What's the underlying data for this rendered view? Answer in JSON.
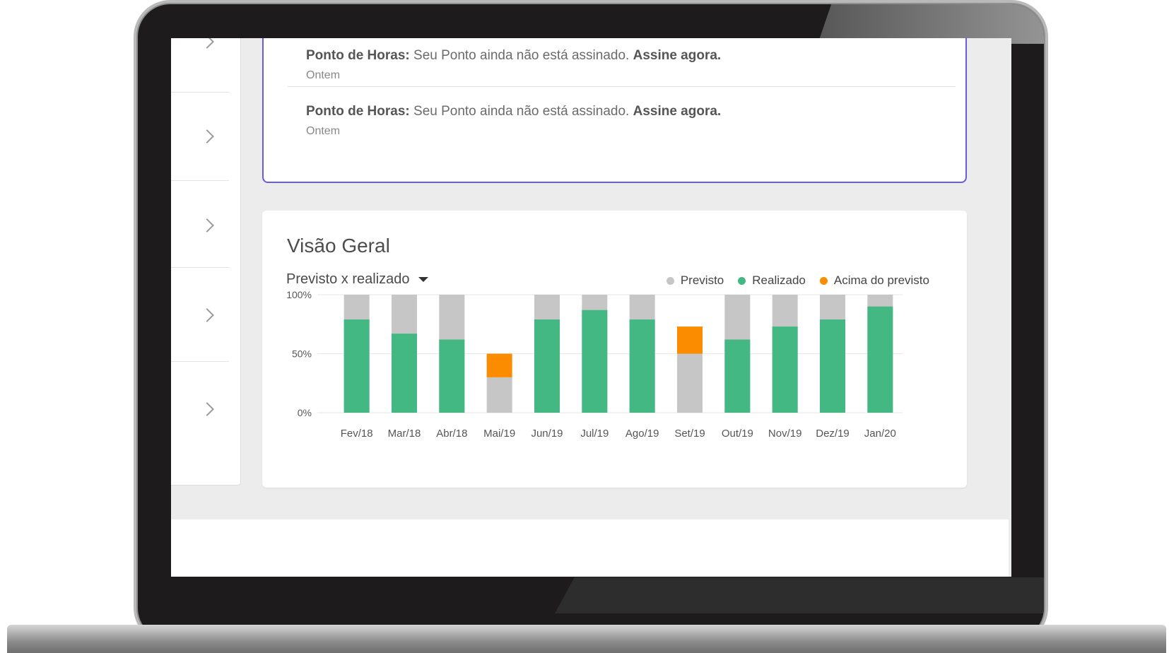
{
  "notifications": [
    {
      "source": "Ponto de Horas:",
      "message": "Seu Ponto ainda não está assinado.",
      "action": "Assine agora.",
      "time": "Ontem"
    },
    {
      "source": "Ponto de Horas:",
      "message": "Seu Ponto ainda não está assinado.",
      "action": "Assine agora.",
      "time": "Ontem"
    }
  ],
  "overview": {
    "title": "Visão Geral",
    "dropdown_label": "Previsto x realizado"
  },
  "colors": {
    "previsto": "#c6c6c6",
    "realizado": "#43b883",
    "acima": "#fb8c00",
    "accent": "#6b5be0"
  },
  "icons": {
    "sidebar_chevron": "chevron-right-icon",
    "dropdown_caret": "caret-down-icon"
  },
  "chart_data": {
    "type": "bar",
    "stacked": true,
    "ytick_labels": [
      "0%",
      "50%",
      "100%"
    ],
    "ylim": [
      0,
      100
    ],
    "grid": true,
    "legend_position": "top-right",
    "categories": [
      "Fev/18",
      "Mar/18",
      "Abr/18",
      "Mai/19",
      "Jun/19",
      "Jul/19",
      "Ago/19",
      "Set/19",
      "Out/19",
      "Nov/19",
      "Dez/19",
      "Jan/20"
    ],
    "series": [
      {
        "name": "Previsto",
        "values": [
          100,
          100,
          100,
          30,
          100,
          100,
          100,
          50,
          100,
          100,
          100,
          100
        ]
      },
      {
        "name": "Realizado",
        "values": [
          79,
          67,
          62,
          0,
          79,
          87,
          79,
          0,
          62,
          73,
          79,
          90
        ]
      },
      {
        "name": "Acima do previsto",
        "values": [
          0,
          0,
          0,
          20,
          0,
          0,
          0,
          23,
          0,
          0,
          0,
          0
        ]
      }
    ]
  }
}
